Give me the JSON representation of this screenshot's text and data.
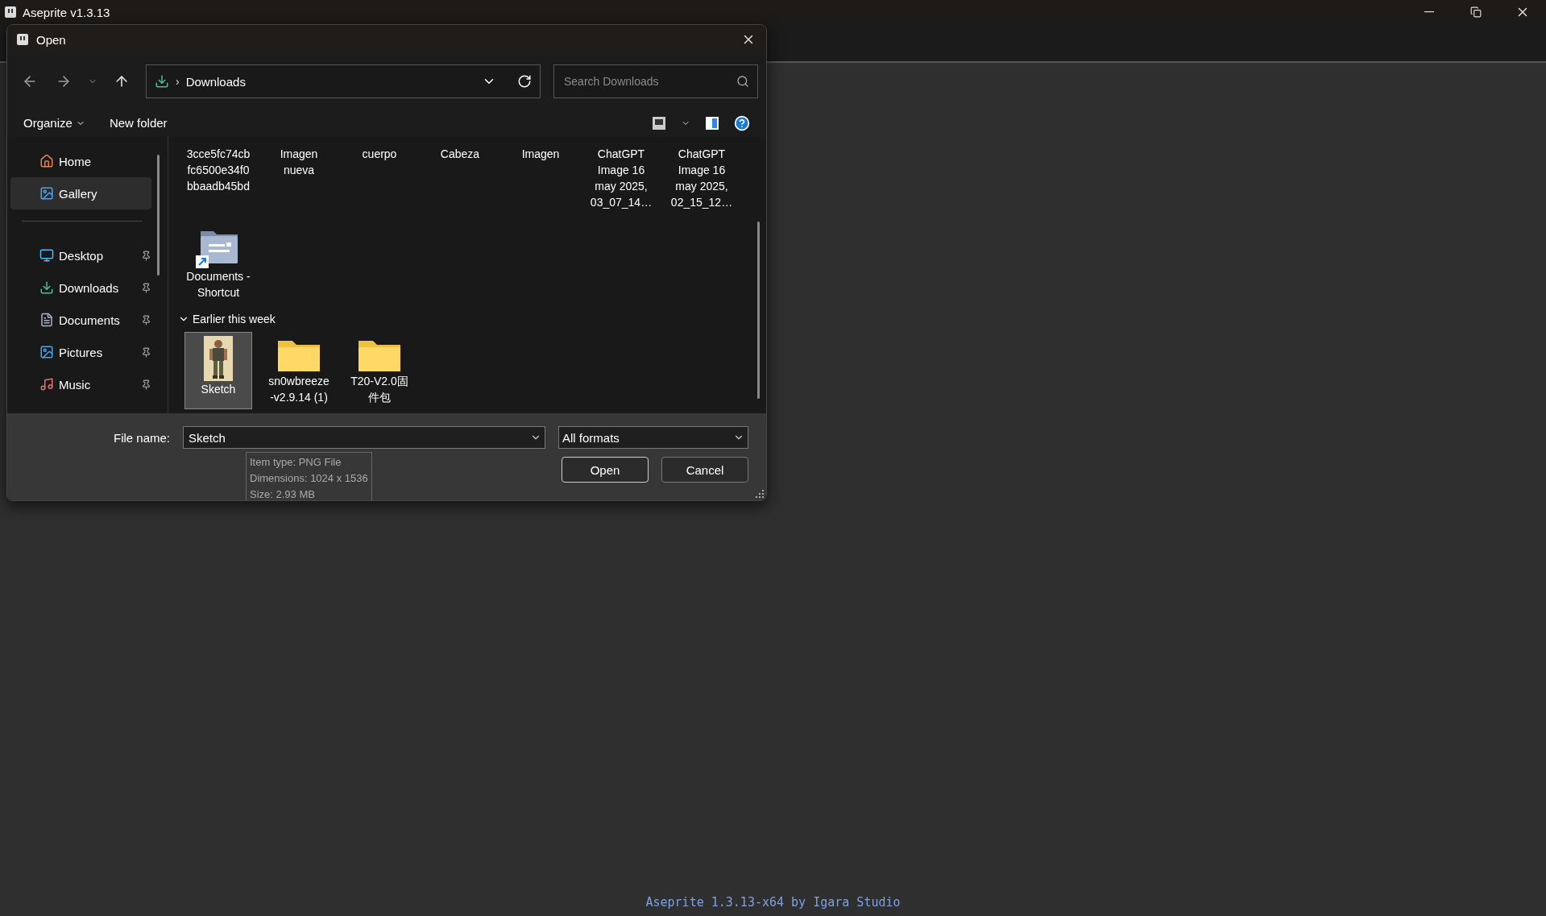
{
  "app": {
    "title": "Aseprite v1.3.13",
    "footer": "Aseprite 1.3.13-x64 by Igara Studio"
  },
  "dialog": {
    "title": "Open",
    "address": {
      "separator": "›",
      "location": "Downloads"
    },
    "search": {
      "placeholder": "Search Downloads"
    },
    "toolbar": {
      "organize": "Organize",
      "new_folder": "New folder"
    },
    "sidebar": {
      "items": [
        {
          "label": "Home",
          "kind": "home",
          "selected": false,
          "pinned": false
        },
        {
          "label": "Gallery",
          "kind": "gallery",
          "selected": true,
          "pinned": false
        },
        {
          "label": "Desktop",
          "kind": "desktop",
          "selected": false,
          "pinned": true
        },
        {
          "label": "Downloads",
          "kind": "downloads",
          "selected": false,
          "pinned": true
        },
        {
          "label": "Documents",
          "kind": "documents",
          "selected": false,
          "pinned": true
        },
        {
          "label": "Pictures",
          "kind": "pictures",
          "selected": false,
          "pinned": true
        },
        {
          "label": "Music",
          "kind": "music",
          "selected": false,
          "pinned": true
        }
      ]
    },
    "groups": [
      {
        "items": [
          {
            "name": "3cce5fc74cbfc6500e34f0bbaadb45bd",
            "kind": "blank",
            "selected": false
          },
          {
            "name": "Imagen nueva",
            "kind": "blank",
            "selected": false
          },
          {
            "name": "cuerpo",
            "kind": "blank",
            "selected": false
          },
          {
            "name": "Cabeza",
            "kind": "blank",
            "selected": false
          },
          {
            "name": "Imagen",
            "kind": "blank",
            "selected": false
          },
          {
            "name": "ChatGPT Image 16 may 2025, 03_07_14…",
            "kind": "blank",
            "selected": false
          },
          {
            "name": "ChatGPT Image 16 may 2025, 02_15_12…",
            "kind": "blank",
            "selected": false
          },
          {
            "name": "Documents - Shortcut",
            "kind": "shortcut",
            "selected": false
          }
        ]
      },
      {
        "header": "Earlier this week",
        "expanded": true,
        "items": [
          {
            "name": "Sketch",
            "selected": true
          },
          {
            "name": "sn0wbreeze-v2.9.14 (1)",
            "kind": "folder",
            "selected": false
          },
          {
            "name": "T20-V2.0固件包",
            "kind": "folder",
            "selected": false
          }
        ]
      }
    ],
    "tooltip": [
      "Item type: PNG File",
      "Dimensions: 1024 x 1536",
      "Size: 2.93 MB"
    ],
    "file_name": {
      "label": "File name:",
      "value": "Sketch"
    },
    "file_type": {
      "value": "All formats"
    },
    "buttons": [
      "Open",
      "Cancel"
    ]
  }
}
